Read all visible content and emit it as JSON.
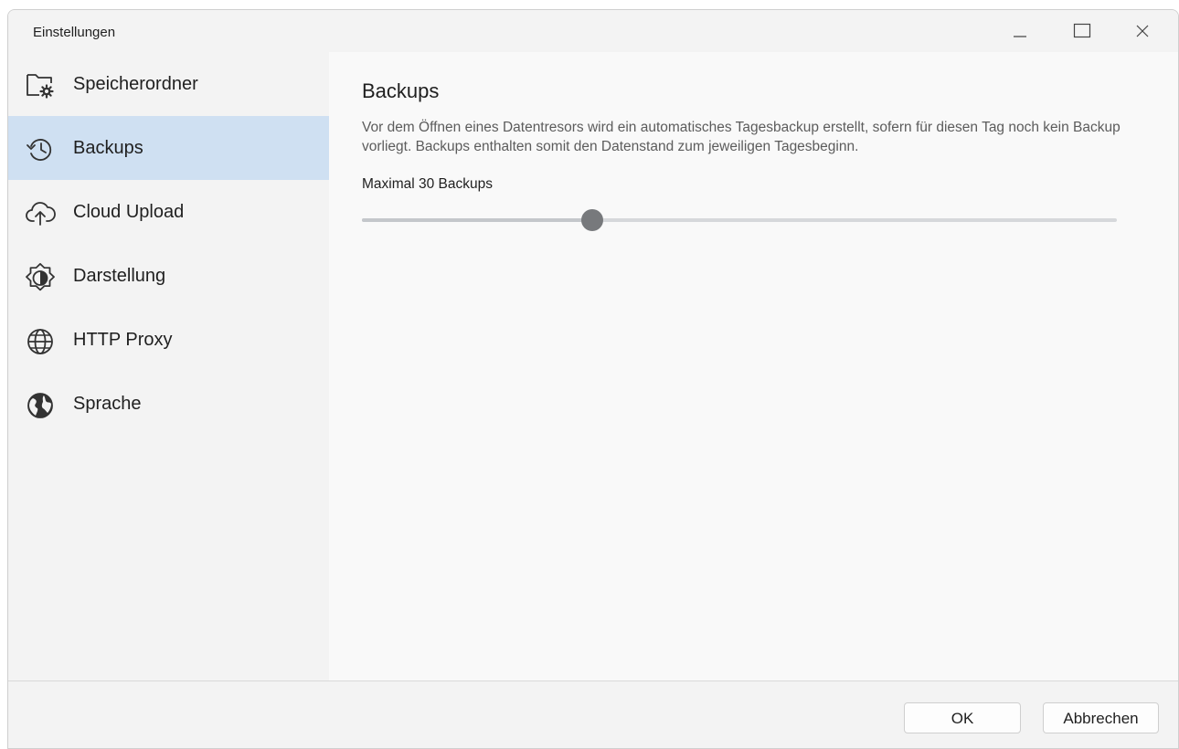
{
  "window": {
    "title": "Einstellungen"
  },
  "sidebar": {
    "items": [
      {
        "label": "Speicherordner",
        "icon": "folder-settings-icon",
        "active": false
      },
      {
        "label": "Backups",
        "icon": "history-icon",
        "active": true
      },
      {
        "label": "Cloud Upload",
        "icon": "cloud-upload-icon",
        "active": false
      },
      {
        "label": "Darstellung",
        "icon": "brightness-icon",
        "active": false
      },
      {
        "label": "HTTP Proxy",
        "icon": "globe-icon",
        "active": false
      },
      {
        "label": "Sprache",
        "icon": "world-icon",
        "active": false
      }
    ]
  },
  "main": {
    "title": "Backups",
    "description": "Vor dem Öffnen eines Datentresors wird ein automatisches Tagesbackup erstellt, sofern für diesen Tag noch kein Backup vorliegt. Backups enthalten somit den Datenstand zum jeweiligen Tagesbeginn.",
    "slider": {
      "label": "Maximal 30 Backups",
      "value": 30,
      "position_fraction": 0.305
    }
  },
  "footer": {
    "ok_label": "OK",
    "cancel_label": "Abbrechen"
  },
  "colors": {
    "active_item": "#cfe0f2",
    "slider_thumb": "#77797c",
    "slider_track": "#d6d8db"
  }
}
